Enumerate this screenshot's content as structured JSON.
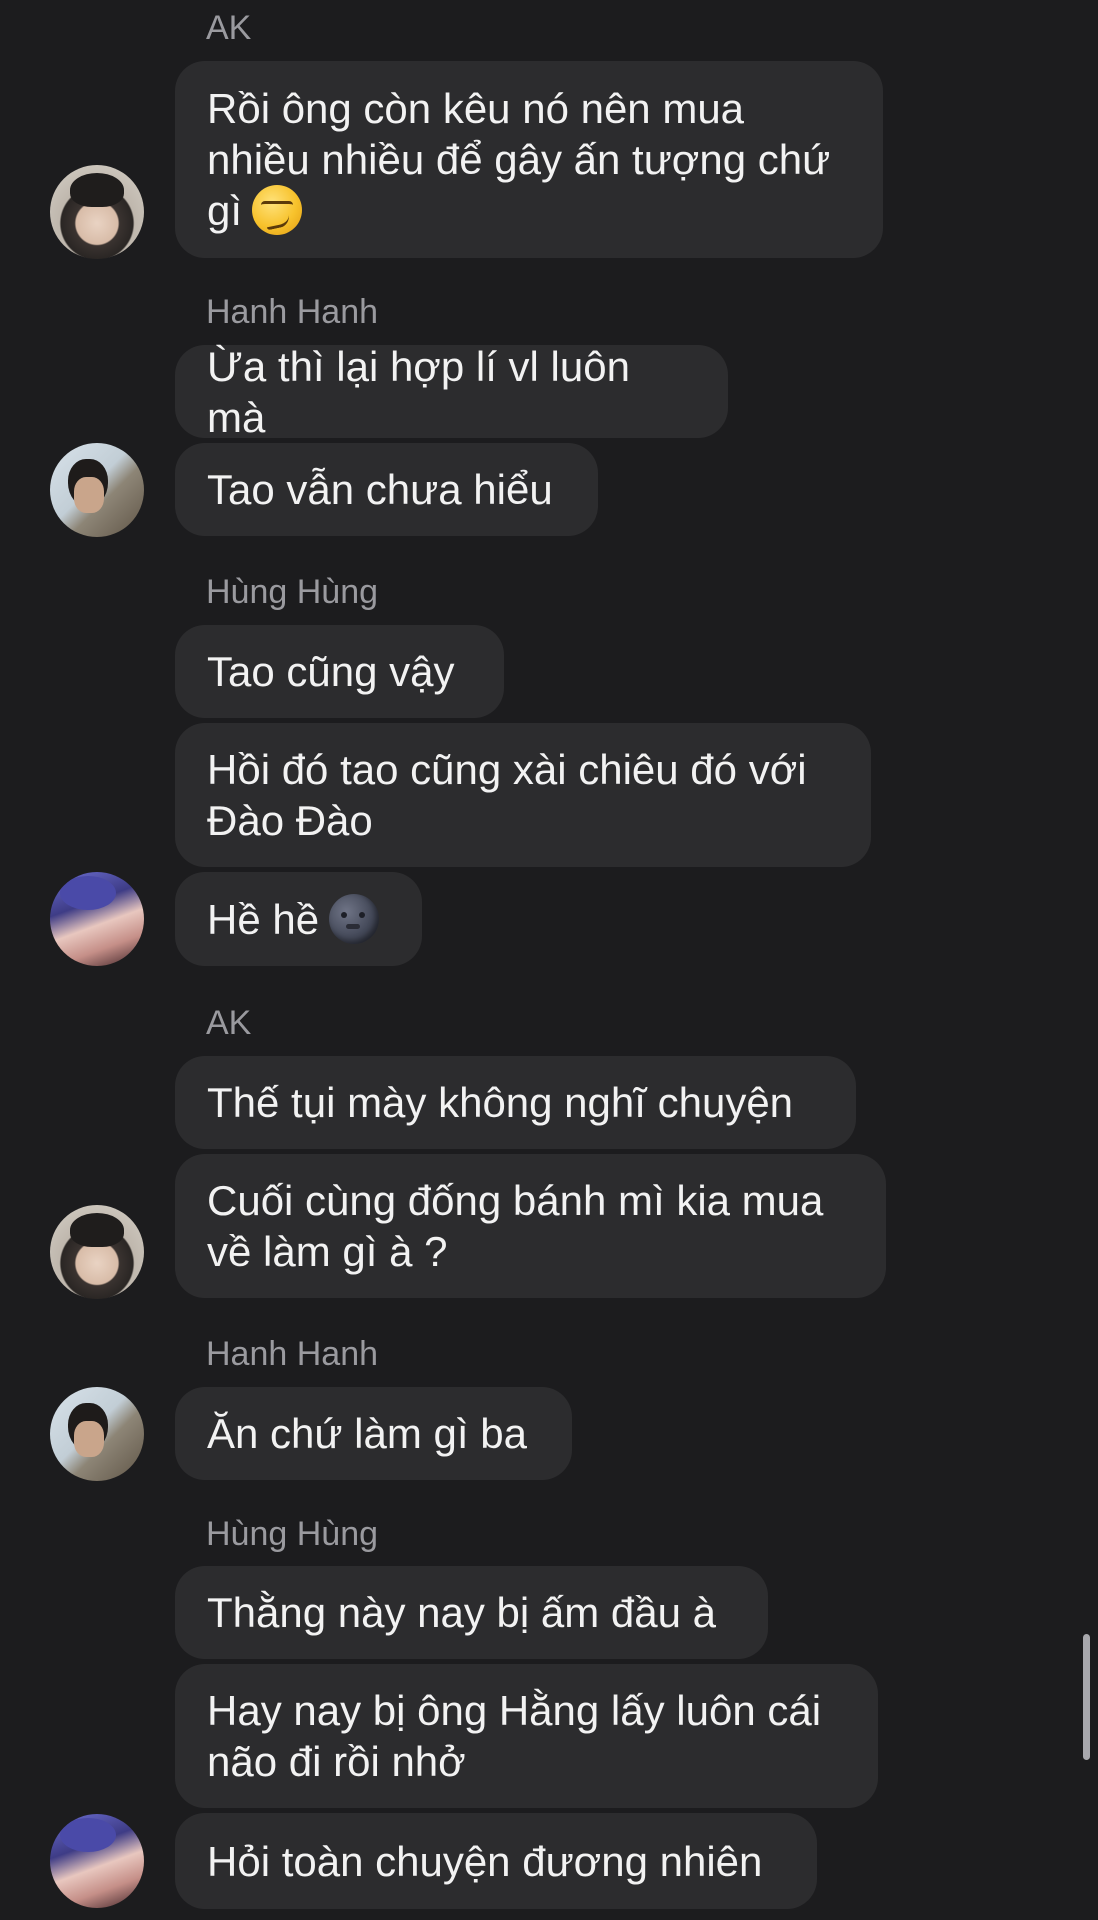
{
  "messages": [
    {
      "sender": "AK",
      "text": "Rồi ông còn kêu nó nên mua\nnhiều nhiều để gây ấn tượng chứ\ngì",
      "emoji": "smirking-face"
    },
    {
      "sender": "Hanh Hanh",
      "text": "Ừa thì lại hợp lí vl luôn mà"
    },
    {
      "text": "Tao vẫn chưa hiểu"
    },
    {
      "sender": "Hùng Hùng",
      "text": "Tao cũng vậy"
    },
    {
      "text": "Hồi đó tao cũng xài chiêu đó với\nĐào Đào"
    },
    {
      "text": "Hề hề",
      "emoji": "new-moon-face"
    },
    {
      "sender": "AK",
      "text": "Thế tụi mày không nghĩ chuyện"
    },
    {
      "text": "Cuối cùng đống bánh mì kia mua\nvề làm gì à ?"
    },
    {
      "sender": "Hanh Hanh",
      "text": "Ăn chứ làm gì ba"
    },
    {
      "sender": "Hùng Hùng",
      "text": "Thằng này nay bị ấm đầu à"
    },
    {
      "text": "Hay nay bị ông Hằng lấy luôn cái\nnão đi rồi nhở"
    },
    {
      "text": "Hỏi toàn chuyện đương nhiên"
    }
  ],
  "avatars": [
    "AK",
    "Hanh Hanh",
    "Hùng Hùng",
    "AK",
    "Hanh Hanh",
    "Hùng Hùng"
  ],
  "colors": {
    "background": "#1c1c1e",
    "bubble": "#2c2c2e",
    "sender_text": "#9a9a9f",
    "message_text": "#f2f2f2"
  }
}
